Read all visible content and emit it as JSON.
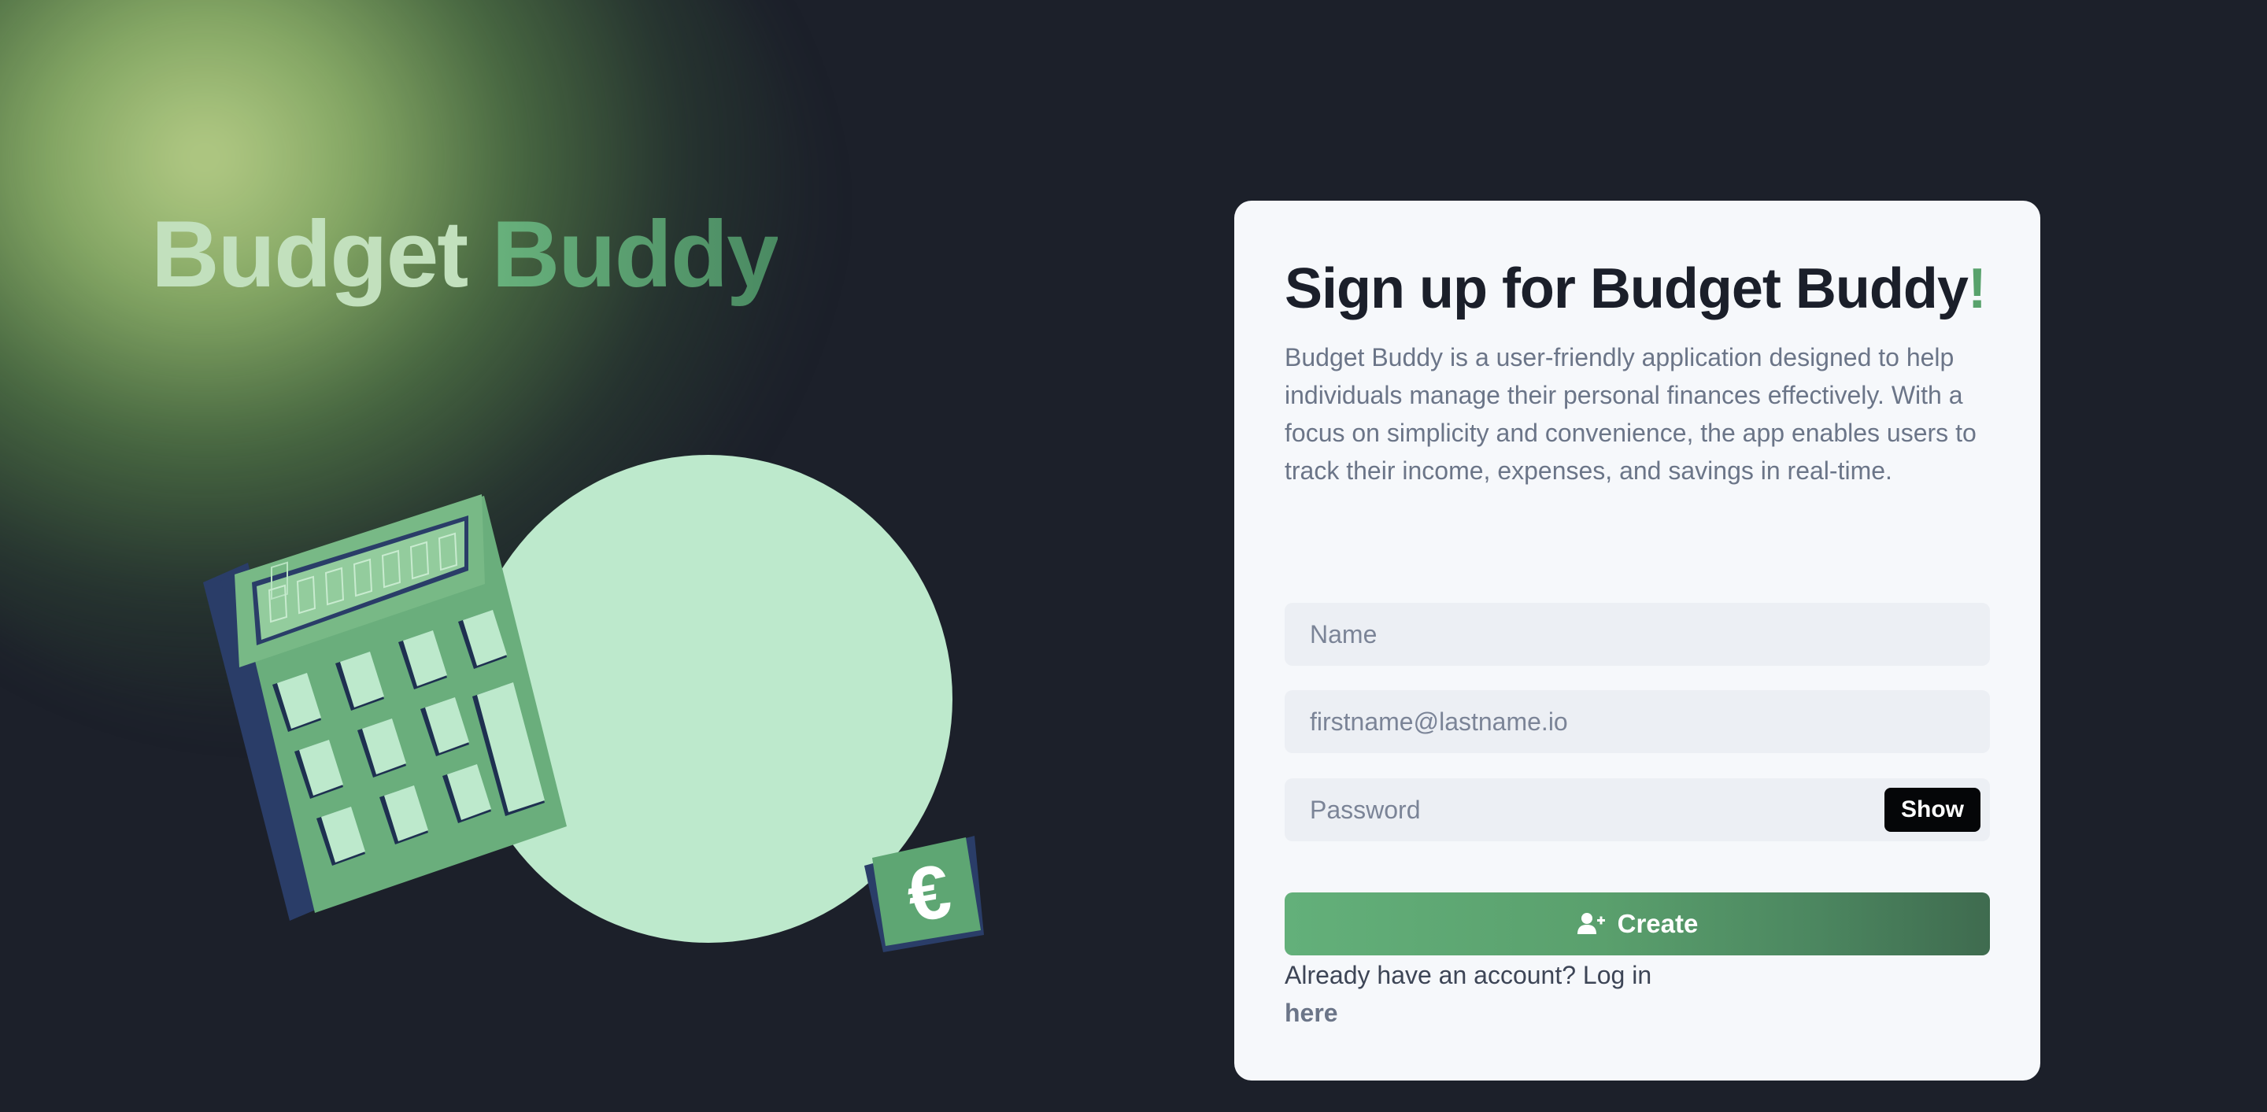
{
  "hero": {
    "brand_word1": "Budget",
    "brand_word2": "Buddy",
    "illustration": {
      "calculator_icon": "calculator-icon",
      "currency_icon": "euro-icon",
      "currency_symbol": "€"
    }
  },
  "signup": {
    "title": "Sign up for Budget Buddy",
    "title_accent": "!",
    "description": "Budget Buddy is a user-friendly application designed to help individuals manage their personal finances effectively. With a focus on simplicity and convenience, the app enables users to track their income, expenses, and savings in real-time.",
    "name_placeholder": "Name",
    "email_placeholder": "firstname@lastname.io",
    "password_placeholder": "Password",
    "show_label": "Show",
    "create_label": "Create",
    "create_icon": "user-plus-icon",
    "login_prompt": "Already have an account? Log in",
    "login_link": "here"
  },
  "colors": {
    "background": "#1c202a",
    "card": "#f6f8fb",
    "accent_green": "#5aa26f",
    "light_green": "#c2e0bd",
    "circle": "#bde9cc",
    "field_bg": "#eceff4"
  }
}
